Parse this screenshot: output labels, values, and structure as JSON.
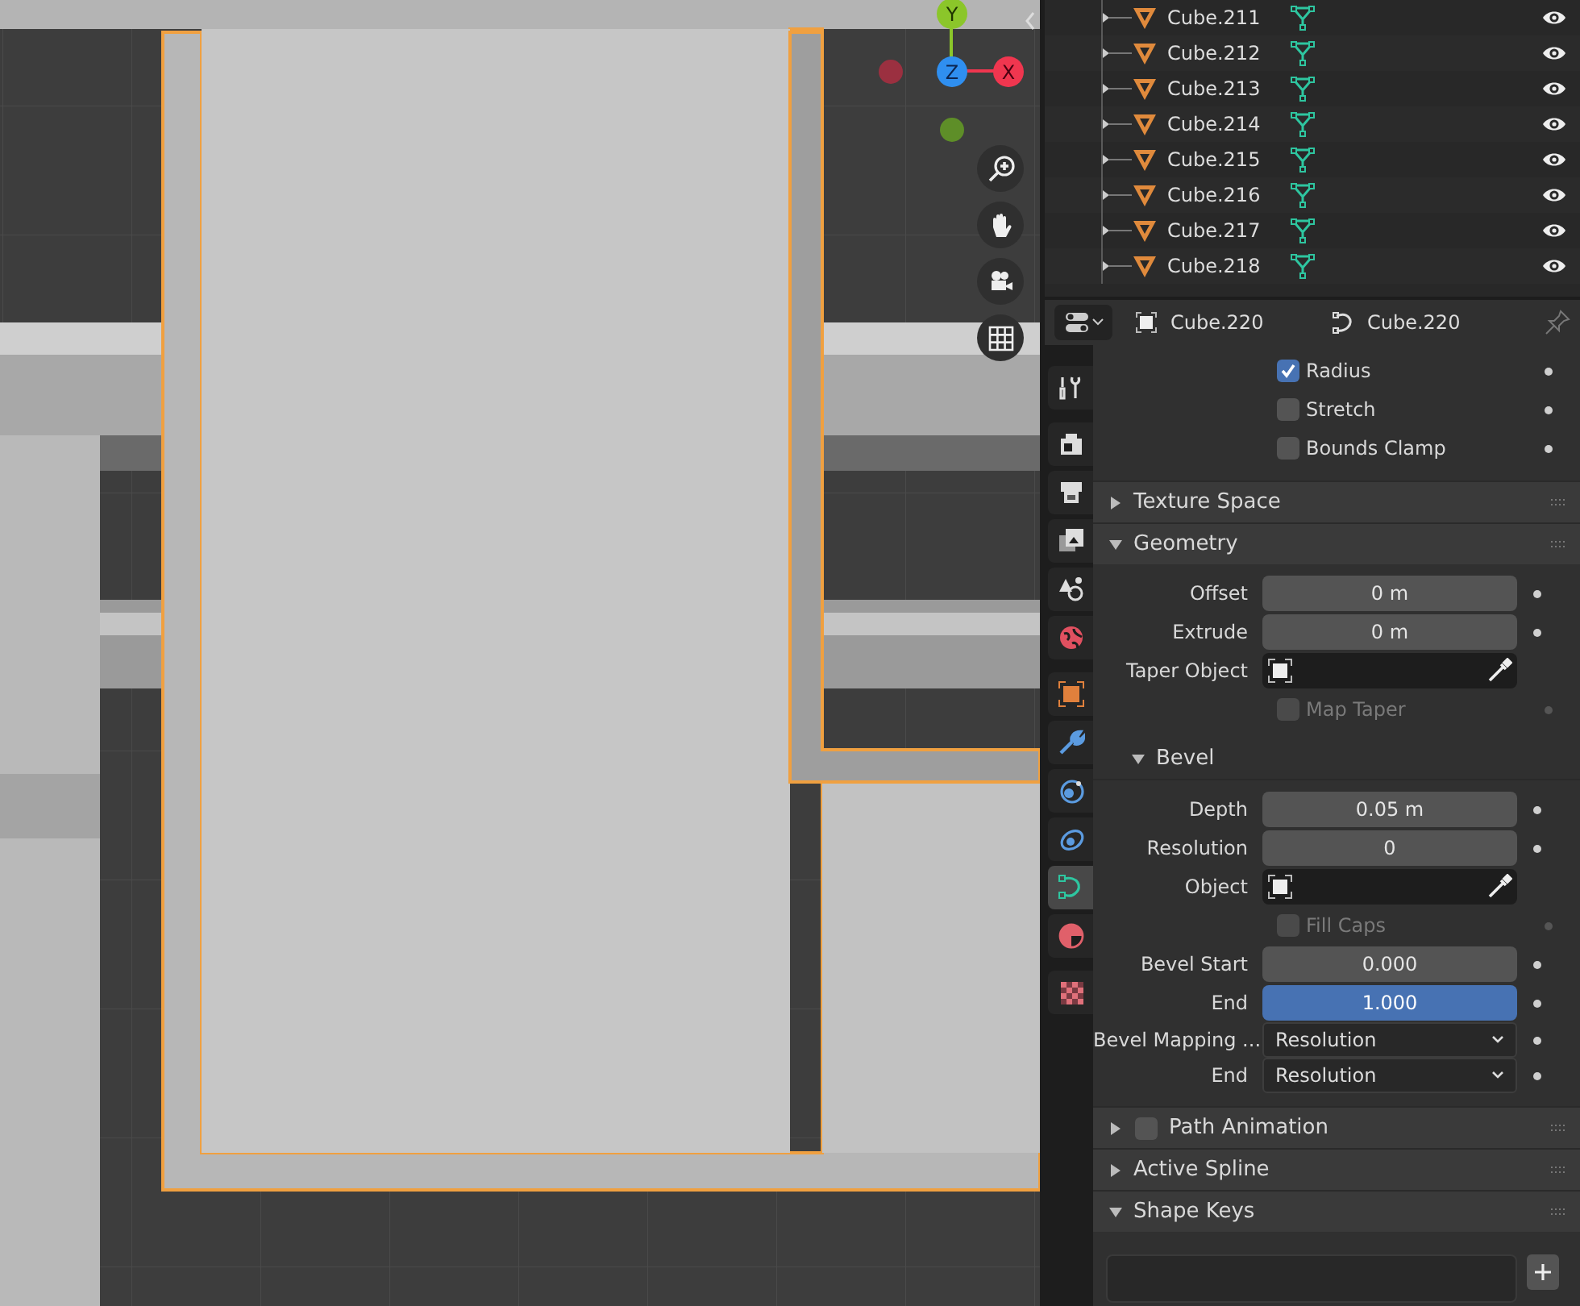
{
  "viewport": {
    "gizmo": [
      {
        "kind": "y",
        "label": "Y"
      },
      {
        "kind": "z",
        "label": "Z"
      },
      {
        "kind": "x",
        "label": "X"
      },
      {
        "kind": "nx"
      },
      {
        "kind": "ny"
      }
    ]
  },
  "outliner": {
    "rows": [
      {
        "name": "Cube.211"
      },
      {
        "name": "Cube.212"
      },
      {
        "name": "Cube.213"
      },
      {
        "name": "Cube.214"
      },
      {
        "name": "Cube.215"
      },
      {
        "name": "Cube.216"
      },
      {
        "name": "Cube.217"
      },
      {
        "name": "Cube.218"
      }
    ]
  },
  "properties": {
    "header": {
      "object": "Cube.220",
      "data": "Cube.220"
    },
    "tabs": [
      {
        "kind": "tool",
        "selected": false
      },
      {
        "kind": "render",
        "selected": false
      },
      {
        "kind": "output",
        "selected": false
      },
      {
        "kind": "view",
        "selected": false
      },
      {
        "kind": "scene",
        "selected": false
      },
      {
        "kind": "world",
        "selected": false
      },
      {
        "kind": "object",
        "selected": false
      },
      {
        "kind": "modifier",
        "selected": false
      },
      {
        "kind": "particles",
        "selected": false
      },
      {
        "kind": "physics",
        "selected": false
      },
      {
        "kind": "data",
        "selected": true
      },
      {
        "kind": "material",
        "selected": false
      },
      {
        "kind": "texture",
        "selected": false
      }
    ],
    "rows": [
      {
        "kind": "checkbox",
        "label": "Radius",
        "checked": true,
        "disabled": false
      },
      {
        "kind": "checkbox",
        "label": "Stretch",
        "checked": false,
        "disabled": false
      },
      {
        "kind": "checkbox",
        "label": "Bounds Clamp",
        "checked": false,
        "disabled": false
      },
      {
        "kind": "panel",
        "label": "Texture Space",
        "expanded": false
      },
      {
        "kind": "panel",
        "label": "Geometry",
        "expanded": true
      },
      {
        "kind": "number",
        "label": "Offset",
        "value": "0 m",
        "selected": false
      },
      {
        "kind": "number",
        "label": "Extrude",
        "value": "0 m",
        "selected": false
      },
      {
        "kind": "object",
        "label": "Taper Object"
      },
      {
        "kind": "checkbox",
        "label": "Map Taper",
        "checked": false,
        "disabled": true
      },
      {
        "kind": "subpanel",
        "label": "Bevel",
        "expanded": true
      },
      {
        "kind": "number",
        "label": "Depth",
        "value": "0.05 m",
        "selected": false
      },
      {
        "kind": "number",
        "label": "Resolution",
        "value": "0",
        "selected": false
      },
      {
        "kind": "object",
        "label": "Object"
      },
      {
        "kind": "checkbox",
        "label": "Fill Caps",
        "checked": false,
        "disabled": true
      },
      {
        "kind": "number",
        "label": "Bevel Start",
        "value": "0.000",
        "selected": false
      },
      {
        "kind": "number",
        "label": "End",
        "value": "1.000",
        "selected": true
      },
      {
        "kind": "dropdown",
        "label": "Bevel Mapping ...",
        "value": "Resolution"
      },
      {
        "kind": "dropdown",
        "label": "End",
        "value": "Resolution"
      },
      {
        "kind": "panel",
        "label": "Path Animation",
        "expanded": false,
        "checked": false
      },
      {
        "kind": "panel",
        "label": "Active Spline",
        "expanded": false
      },
      {
        "kind": "panel",
        "label": "Shape Keys",
        "expanded": true
      },
      {
        "kind": "list"
      }
    ]
  }
}
